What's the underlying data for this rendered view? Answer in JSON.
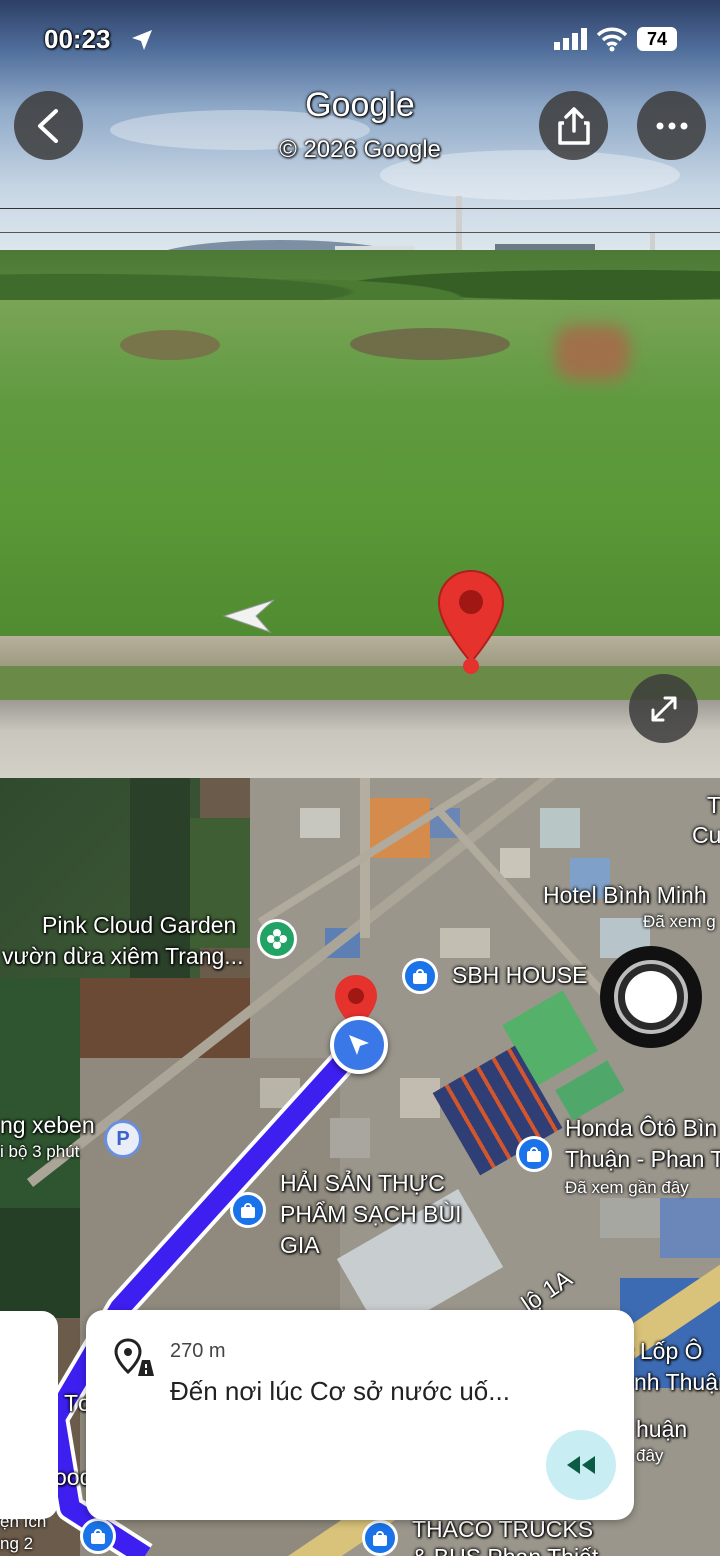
{
  "status_bar": {
    "time": "00:23",
    "battery": "74"
  },
  "street_view": {
    "title": "Google",
    "copyright": "© 2026 Google",
    "icons": {
      "back": "chevron-left-icon",
      "share": "share-icon",
      "more": "more-horiz-icon",
      "expand": "expand-icon",
      "arrow": "nav-arrow-icon",
      "pin": "red-pin-icon"
    }
  },
  "map": {
    "pois": {
      "pink_cloud": {
        "line1": "Pink Cloud Garden",
        "line2": "vườn dừa xiêm Trang..."
      },
      "sbh_house": "SBH HOUSE",
      "hotel": {
        "line1": "Hotel Bình Minh",
        "line2": "Đã xem g"
      },
      "top_right": {
        "line1": "T",
        "line2": "Cu"
      },
      "parking": {
        "line1": "ng xeben",
        "line2": "i bộ 3 phút",
        "icon_text": "P"
      },
      "hai_san": {
        "line1": "HẢI SẢN THỰC",
        "line2": "PHẨM SẠCH BÙI",
        "line3": "GIA"
      },
      "honda": {
        "line1": "Honda Ôtô Bìn",
        "line2": "Thuận - Phan T",
        "line3": "Đã xem gần đây"
      },
      "road": "lộ 1A",
      "lop": {
        "line1": "c Lốp Ô",
        "line2": "nh Thuận",
        "line3": "huận",
        "line4": "đây"
      },
      "thaco": {
        "line1": "THACO TRUCKS",
        "line2": "& BUS Phan Thiết"
      },
      "left_edge": {
        "line1": "Tơ",
        "line2": "ood",
        "line3": "ện ích",
        "line4": "ng 2"
      }
    }
  },
  "nav_card": {
    "distance": "270 m",
    "instruction": "Đến nơi lúc Cơ sở nước uố..."
  },
  "colors": {
    "route": "#3d1ff0",
    "pin": "#e5322d",
    "poi": "#1a73e8",
    "rewind_bg": "#c8eef4",
    "rewind_icon": "#0c5b45"
  }
}
